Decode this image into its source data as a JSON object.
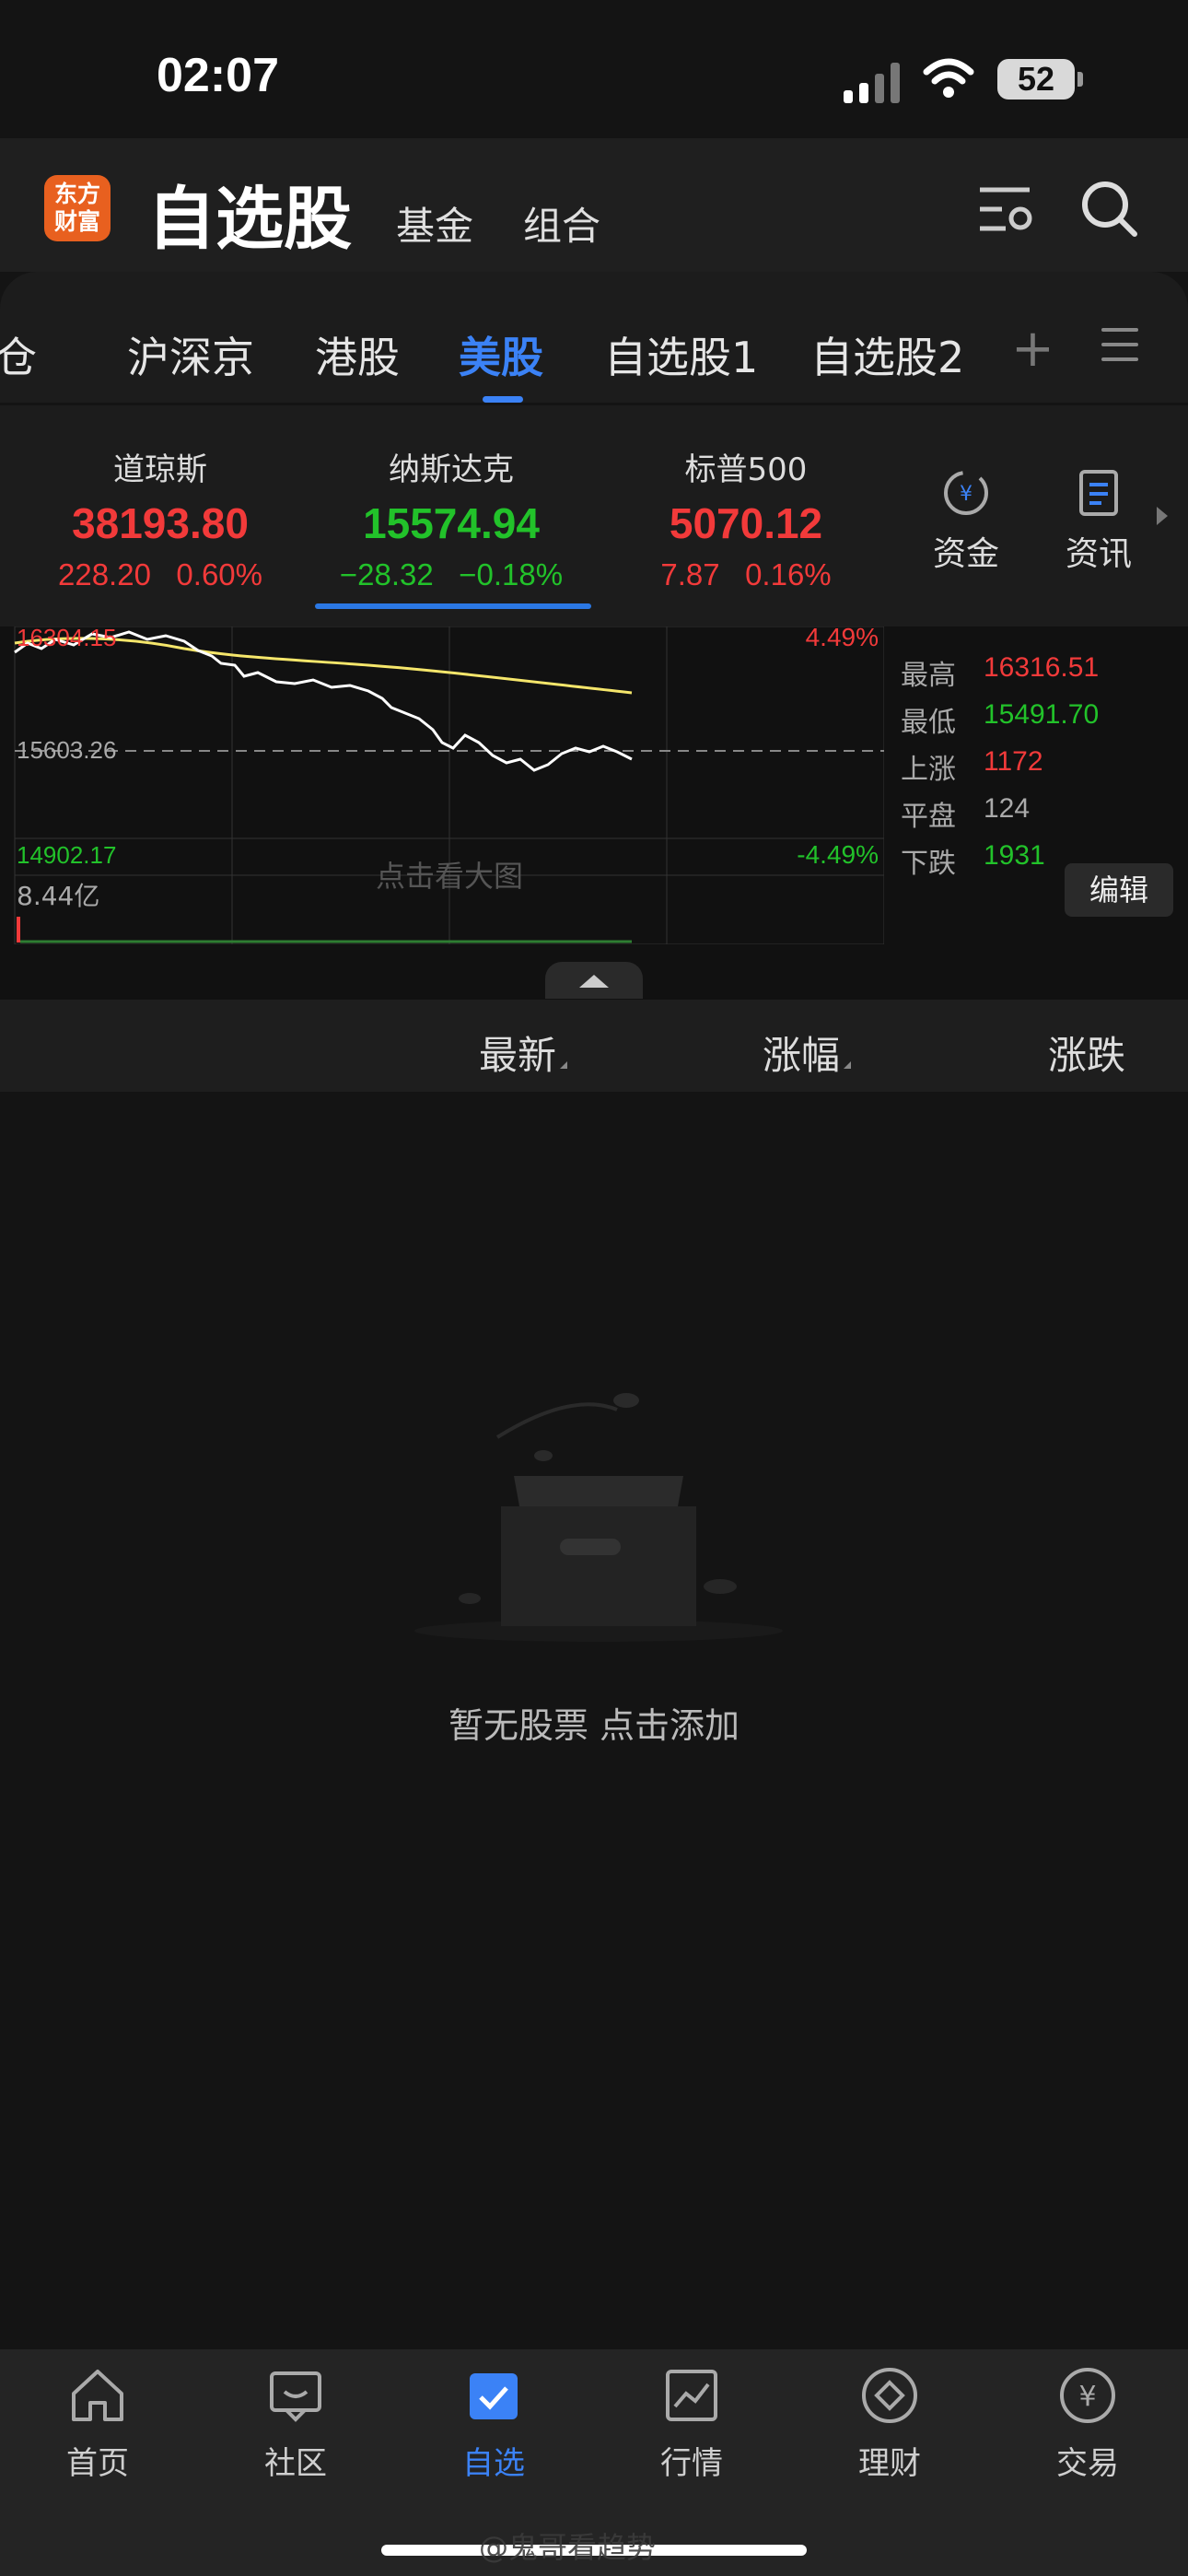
{
  "status_bar": {
    "time": "02:07",
    "battery": "52"
  },
  "header": {
    "logo_line1": "东方",
    "logo_line2": "财富",
    "title": "自选股",
    "links": [
      "基金",
      "组合"
    ]
  },
  "tabs": {
    "items": [
      "仓",
      "沪深京",
      "港股",
      "美股",
      "自选股1",
      "自选股2"
    ],
    "active_index": 3
  },
  "indices": [
    {
      "name": "道琼斯",
      "value": "38193.80",
      "change": "228.20   0.60%",
      "color": "#f23a3a"
    },
    {
      "name": "纳斯达克",
      "value": "15574.94",
      "change": "−28.32   −0.18%",
      "color": "#22c22a"
    },
    {
      "name": "标普500",
      "value": "5070.12",
      "change": "7.87   0.16%",
      "color": "#f23a3a"
    }
  ],
  "side_buttons": {
    "funds": "资金",
    "news": "资讯"
  },
  "chart": {
    "high_label": "16304.15",
    "mid_label": "15603.26",
    "low_label": "14902.17",
    "up_pct": "4.49%",
    "down_pct": "-4.49%",
    "volume": "8.44亿",
    "hint": "点击看大图"
  },
  "stats": {
    "labels": [
      "最高",
      "最低",
      "上涨",
      "平盘",
      "下跌"
    ],
    "values": [
      "16316.51",
      "15491.70",
      "1172",
      "124",
      "1931"
    ],
    "colors": [
      "#f23a3a",
      "#22c22a",
      "#f23a3a",
      "#aaaaaa",
      "#22c22a"
    ],
    "edit": "编辑"
  },
  "columns": [
    "最新",
    "涨幅",
    "涨跌"
  ],
  "empty_state": "暂无股票 点击添加",
  "bottom_nav": {
    "items": [
      "首页",
      "社区",
      "自选",
      "行情",
      "理财",
      "交易"
    ],
    "active_index": 2
  },
  "watermark": "@鬼哥看趋势",
  "colors": {
    "accent": "#3b82f6",
    "up": "#f23a3a",
    "down": "#22c22a",
    "brand": "#e8601f"
  }
}
